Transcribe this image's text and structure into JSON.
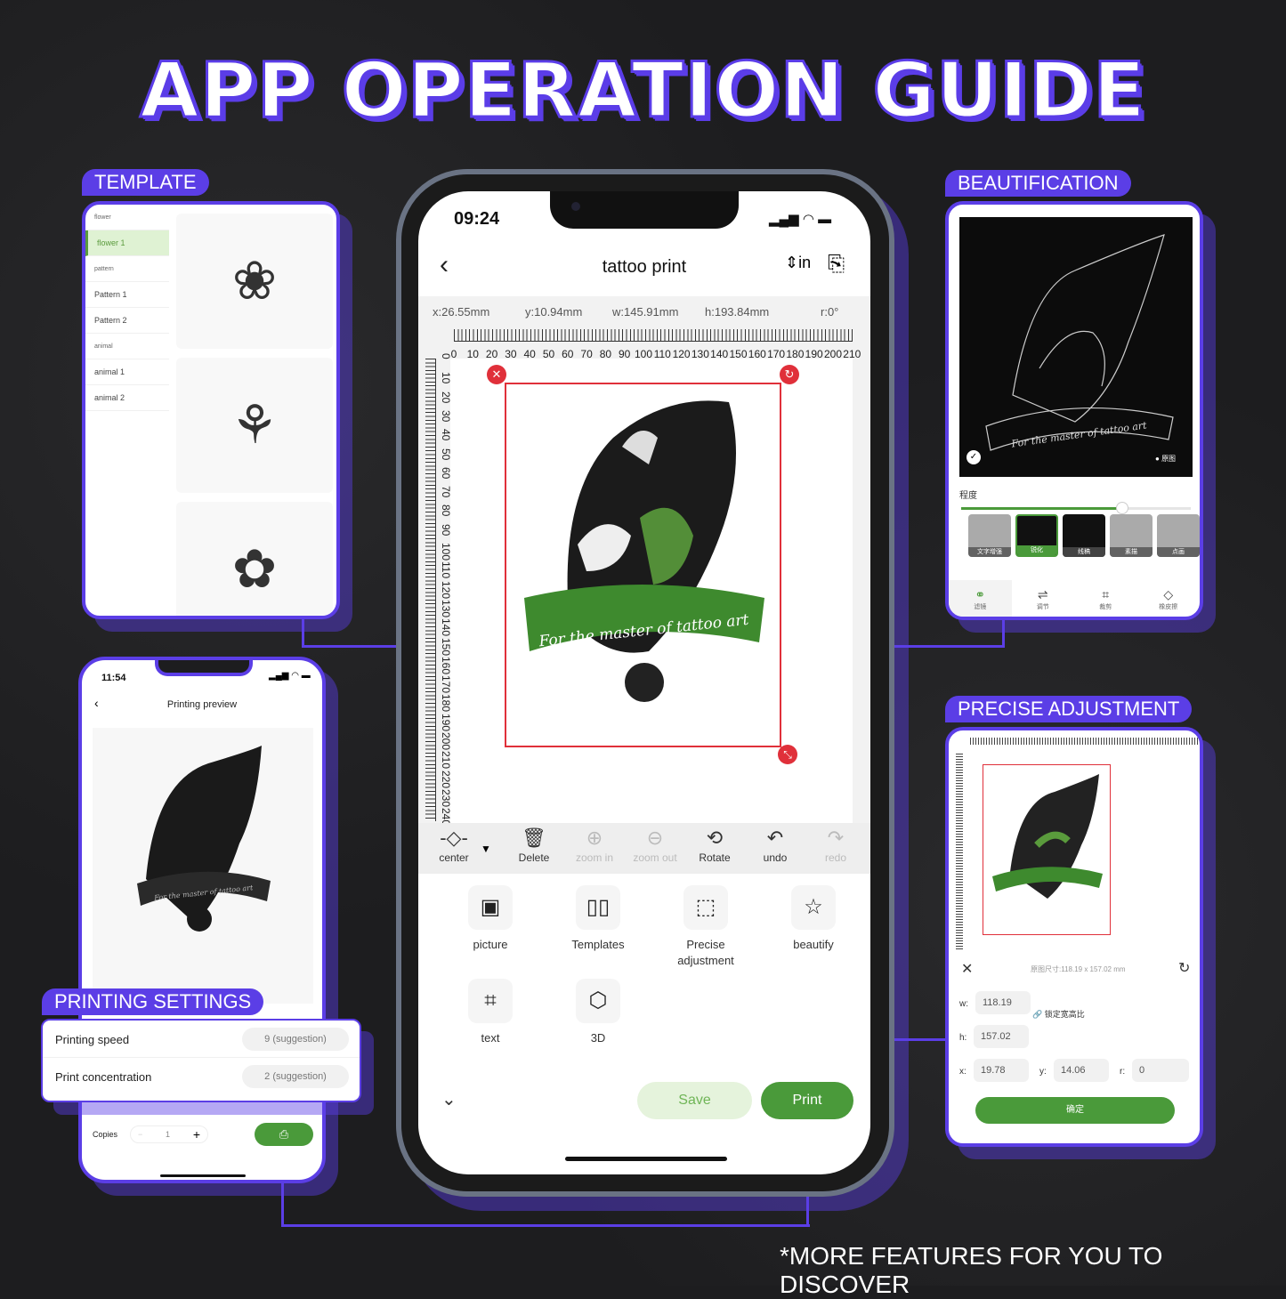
{
  "title": "APP OPERATION GUIDE",
  "footer": "*MORE FEATURES FOR YOU TO DISCOVER",
  "colors": {
    "accent": "#5b3ee6",
    "green": "#4a9a3a",
    "red": "#e0303a"
  },
  "template": {
    "label": "TEMPLATE",
    "items": [
      {
        "t": "flower",
        "cat": true
      },
      {
        "t": "flower 1",
        "sel": true
      },
      {
        "t": "pattern",
        "cat": true
      },
      {
        "t": "Pattern 1"
      },
      {
        "t": "Pattern 2"
      },
      {
        "t": "animal",
        "cat": true
      },
      {
        "t": "animal 1"
      },
      {
        "t": "animal 2"
      }
    ]
  },
  "beautification": {
    "label": "BEAUTIFICATION",
    "original_toggle": "原图",
    "degree_label": "程度",
    "degree_value": 0.7,
    "filters": [
      "文字增强",
      "锐化",
      "线稿",
      "素描",
      "点画"
    ],
    "selected_filter": "锐化",
    "tabs": [
      "滤镜",
      "调节",
      "裁剪",
      "橡皮擦"
    ]
  },
  "precise": {
    "label": "PRECISE ADJUSTMENT",
    "original_size": "原图尺寸:118.19 x 157.02 mm",
    "w_label": "w:",
    "w": "118.19",
    "h_label": "h:",
    "h": "157.02",
    "lock": "锁定宽高比",
    "x_label": "x:",
    "x": "19.78",
    "y_label": "y:",
    "y": "14.06",
    "r_label": "r:",
    "r": "0",
    "confirm": "确定"
  },
  "preview": {
    "time": "11:54",
    "title": "Printing preview",
    "copies_label": "Copies",
    "copies": "1"
  },
  "settings": {
    "label": "PRINTING SETTINGS",
    "rows": [
      {
        "name": "Printing speed",
        "value": "9  (suggestion)"
      },
      {
        "name": "Print concentration",
        "value": "2  (suggestion)"
      }
    ]
  },
  "main": {
    "time": "09:24",
    "title": "tattoo print",
    "coords": {
      "x": "x:26.55mm",
      "y": "y:10.94mm",
      "w": "w:145.91mm",
      "h": "h:193.84mm",
      "r": "r:0°"
    },
    "ruler": [
      "0",
      "10",
      "20",
      "30",
      "40",
      "50",
      "60",
      "70",
      "80",
      "90",
      "100",
      "110",
      "120",
      "130",
      "140",
      "150",
      "160",
      "170",
      "180",
      "190",
      "200",
      "210"
    ],
    "vruler": [
      "0",
      "10",
      "20",
      "30",
      "40",
      "50",
      "60",
      "70",
      "80",
      "90",
      "100",
      "110",
      "120",
      "130",
      "140",
      "150",
      "160",
      "170",
      "180",
      "190",
      "200",
      "210",
      "220",
      "230",
      "240"
    ],
    "art_text": "For the master of tattoo art",
    "toolbar": [
      {
        "l": "center",
        "i": "-◇-",
        "on": true
      },
      {
        "l": "Delete",
        "i": "🗑",
        "on": true
      },
      {
        "l": "zoom in",
        "i": "⊕",
        "on": false
      },
      {
        "l": "zoom out",
        "i": "⊖",
        "on": false
      },
      {
        "l": "Rotate",
        "i": "⟲",
        "on": true
      },
      {
        "l": "undo",
        "i": "↶",
        "on": true
      },
      {
        "l": "redo",
        "i": "↷",
        "on": false
      }
    ],
    "features": [
      {
        "l": "picture",
        "i": "▣"
      },
      {
        "l": "Templates",
        "i": "▯▯"
      },
      {
        "l": "Precise adjustment",
        "i": "⬚"
      },
      {
        "l": "beautify",
        "i": "☆"
      },
      {
        "l": "text",
        "i": "⌗"
      },
      {
        "l": "3D",
        "i": "⬡"
      }
    ],
    "save": "Save",
    "print": "Print"
  }
}
